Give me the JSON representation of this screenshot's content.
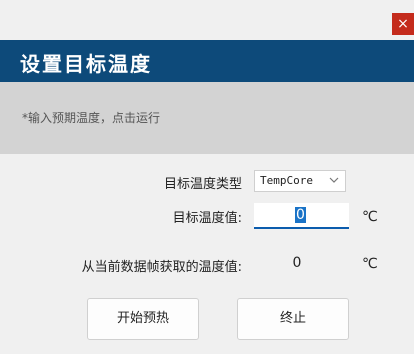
{
  "window": {
    "close_symbol": "×"
  },
  "header": {
    "title": "设置目标温度"
  },
  "hint": {
    "text": "*输入预期温度，点击运行"
  },
  "form": {
    "type_label": "目标温度类型",
    "type_value": "TempCore",
    "value_label": "目标温度值:",
    "value_input": "0",
    "value_unit": "℃",
    "current_label": "从当前数据帧获取的温度值:",
    "current_value": "0",
    "current_unit": "℃"
  },
  "buttons": {
    "start_label": "开始预热",
    "stop_label": "终止"
  },
  "colors": {
    "header_bg": "#0d4a7a",
    "close_bg": "#c42b1c",
    "hint_bg": "#d3d3d3",
    "input_accent": "#0b5cad"
  }
}
